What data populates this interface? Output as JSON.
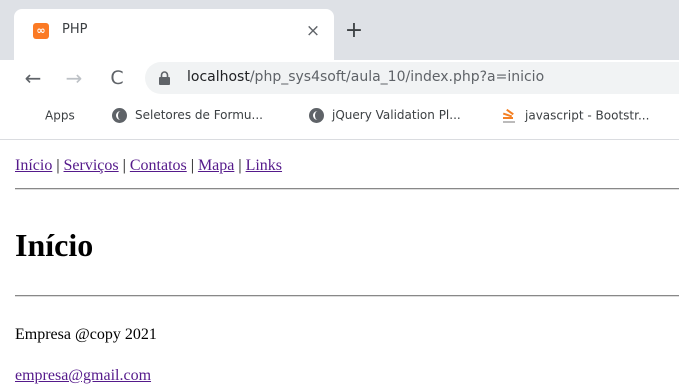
{
  "browser": {
    "tab": {
      "title": "PHP",
      "favicon": "xampp-icon",
      "close_glyph": "×"
    },
    "new_tab_glyph": "+",
    "nav": {
      "back_glyph": "←",
      "forward_glyph": "→",
      "reload_glyph": "C"
    },
    "address": {
      "host": "localhost",
      "path": "/php_sys4soft/aula_10/index.php?a=inicio"
    },
    "bookmarks": [
      {
        "label": "Apps",
        "icon": "apps-grid-icon"
      },
      {
        "label": "Seletores de Formu...",
        "icon": "globe-icon"
      },
      {
        "label": "jQuery Validation Pl...",
        "icon": "globe-icon"
      },
      {
        "label": "javascript - Bootstr...",
        "icon": "stackoverflow-icon"
      }
    ]
  },
  "page": {
    "menu": [
      {
        "label": "Início"
      },
      {
        "label": "Serviços"
      },
      {
        "label": "Contatos"
      },
      {
        "label": "Mapa"
      },
      {
        "label": "Links"
      }
    ],
    "menu_separator": "|",
    "heading": "Início",
    "footer_text": "Empresa @copy 2021",
    "email": "empresa@gmail.com"
  },
  "colors": {
    "tab_strip": "#dee1e6",
    "omnibox": "#f1f3f4",
    "favicon": "#fb7a24",
    "link": "#551a8b"
  }
}
